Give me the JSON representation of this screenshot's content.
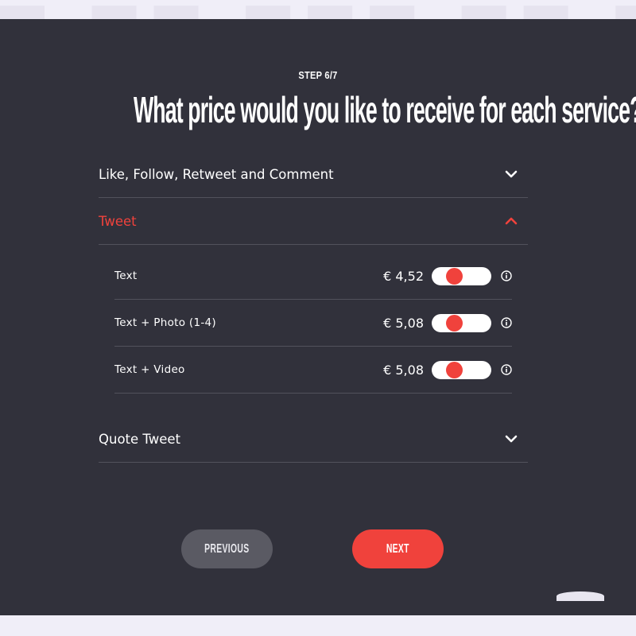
{
  "header": {
    "step": "STEP 6/7",
    "title": "What price would you like to receive for each service?"
  },
  "accordion": [
    {
      "label": "Like, Follow, Retweet and Comment",
      "state": "collapsed",
      "icon": "chevron-down-icon"
    },
    {
      "label": "Tweet",
      "state": "expanded",
      "icon": "chevron-up-icon"
    },
    {
      "label": "Quote Tweet",
      "state": "collapsed",
      "icon": "chevron-down-icon"
    }
  ],
  "tweet_services": [
    {
      "label": "Text",
      "price": "€ 4,52",
      "toggle_level": 0.33
    },
    {
      "label": "Text + Photo (1-4)",
      "price": "€ 5,08",
      "toggle_level": 0.33
    },
    {
      "label": "Text + Video",
      "price": "€ 5,08",
      "toggle_level": 0.33
    }
  ],
  "nav": {
    "previous": "PREVIOUS",
    "next": "NEXT"
  },
  "colors": {
    "panel": "#31313b",
    "accent": "#f0423c",
    "divider": "#52525c",
    "previous_button": "#5a5a63"
  }
}
